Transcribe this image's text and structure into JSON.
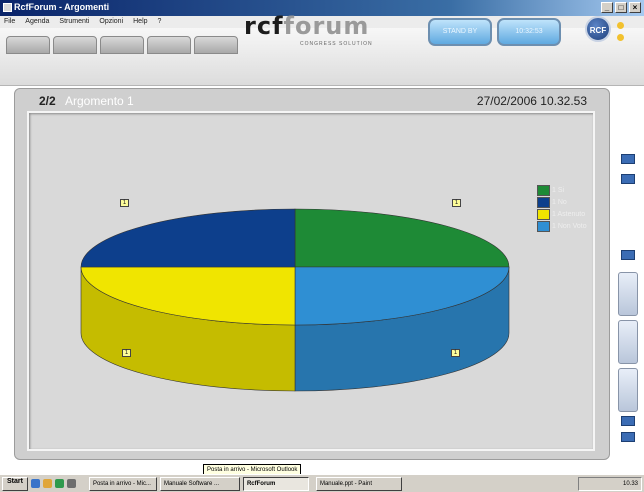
{
  "window": {
    "title": "RcfForum - Argomenti",
    "controls": [
      "_",
      "□",
      "×"
    ]
  },
  "menu": {
    "items": [
      "File",
      "Agenda",
      "Strumenti",
      "Opzioni",
      "Help",
      "?"
    ]
  },
  "header": {
    "logo_main": "rcf",
    "logo_accent": "forum",
    "logo_sub": "CONGRESS SOLUTION",
    "btn1_label": "STAND BY",
    "btn2_label": "10:32:53",
    "badge": "RCF"
  },
  "panel": {
    "page_num": "2/2",
    "topic_title": "Argomento 1",
    "datetime": "27/02/2006 10.32.53"
  },
  "chart_data": {
    "type": "pie",
    "categories": [
      "1 Si",
      "1 No",
      "1 Astenuto",
      "1 Non Voto"
    ],
    "values": [
      1,
      1,
      1,
      1
    ],
    "data_labels": [
      "1",
      "1",
      "1",
      "1"
    ],
    "colors": [
      "#1e8a36",
      "#0d3f8c",
      "#f0e500",
      "#2f8fd3"
    ],
    "legend_position": "top-right",
    "style": "3d"
  },
  "taskbar": {
    "start": "Start",
    "tasks": [
      "Posta in arrivo - Mic...",
      "Manuale Software ...",
      "RcfForum",
      "Manuale.ppt - Paint"
    ],
    "active_task": 2,
    "clock": "10.33",
    "tooltip": "Posta in arrivo - Microsoft Outlook"
  }
}
